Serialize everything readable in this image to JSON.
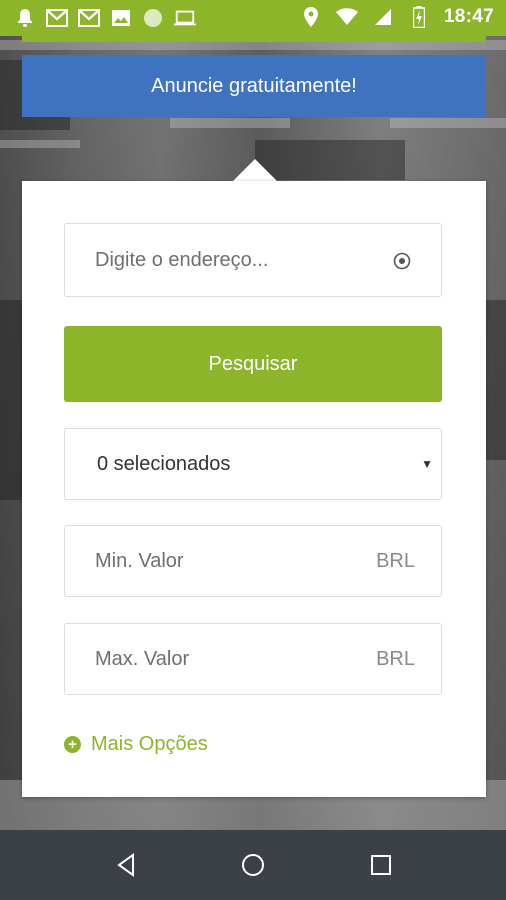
{
  "status_bar": {
    "time": "18:47",
    "left_icons": [
      "notification-bell-icon",
      "gmail-icon",
      "gmail-icon",
      "image-icon",
      "circle-icon",
      "laptop-icon"
    ],
    "right_icons": [
      "location-icon",
      "wifi-icon",
      "signal-icon",
      "battery-charging-icon"
    ],
    "bar_color": "#8db52a"
  },
  "announce": {
    "label": "Anuncie gratuitamente!",
    "color": "#3f72bf"
  },
  "search_form": {
    "address": {
      "placeholder": "Digite o endereço...",
      "icon": "locate-icon"
    },
    "search_button": {
      "label": "Pesquisar",
      "color": "#8db52a"
    },
    "type_select": {
      "value": "0 selecionados",
      "icon": "caret-down-icon"
    },
    "min_value": {
      "placeholder": "Min. Valor",
      "unit": "BRL"
    },
    "max_value": {
      "placeholder": "Max. Valor",
      "unit": "BRL"
    },
    "more_options": {
      "label": "Mais Opções",
      "icon": "plus-circle-icon"
    }
  },
  "nav_bar": {
    "buttons": [
      "back-icon",
      "home-icon",
      "recents-icon"
    ],
    "color": "#3b4147"
  }
}
